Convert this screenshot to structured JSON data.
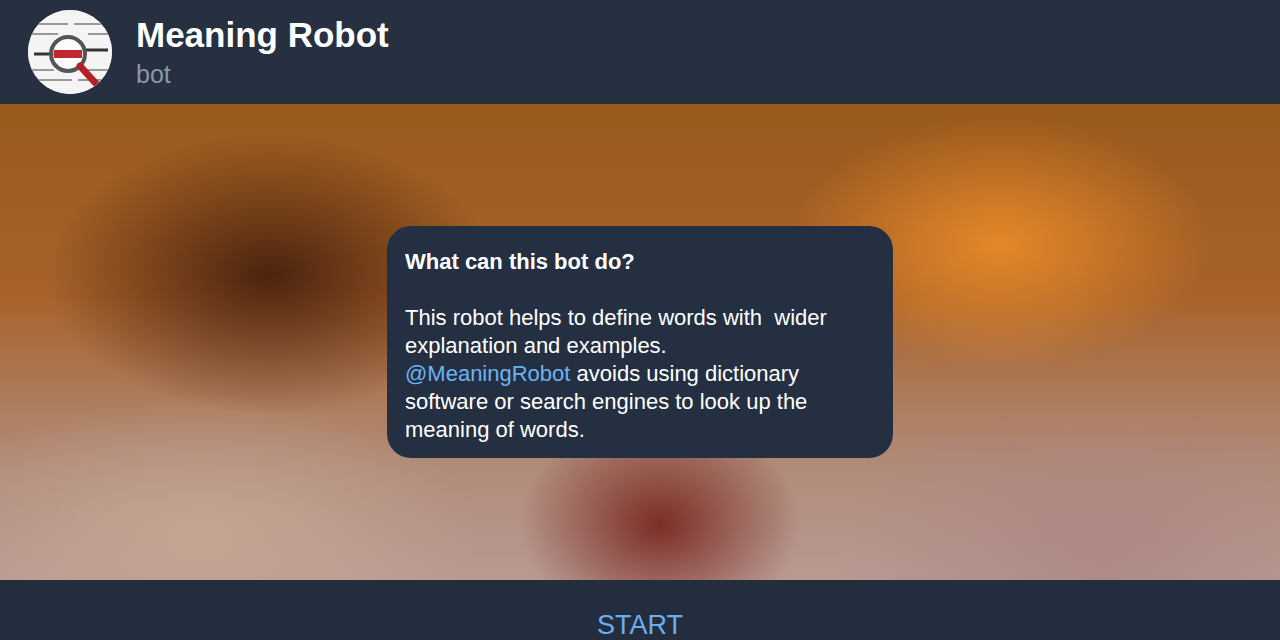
{
  "header": {
    "title": "Meaning Robot",
    "subtitle": "bot"
  },
  "intro": {
    "heading": "What can this bot do?",
    "text_before": "This robot helps to define words with  wider explanation and examples.",
    "mention": "@MeaningRobot",
    "text_after": " avoids using dictionary software or search engines to look up the meaning of words."
  },
  "buttons": [
    "START"
  ]
}
